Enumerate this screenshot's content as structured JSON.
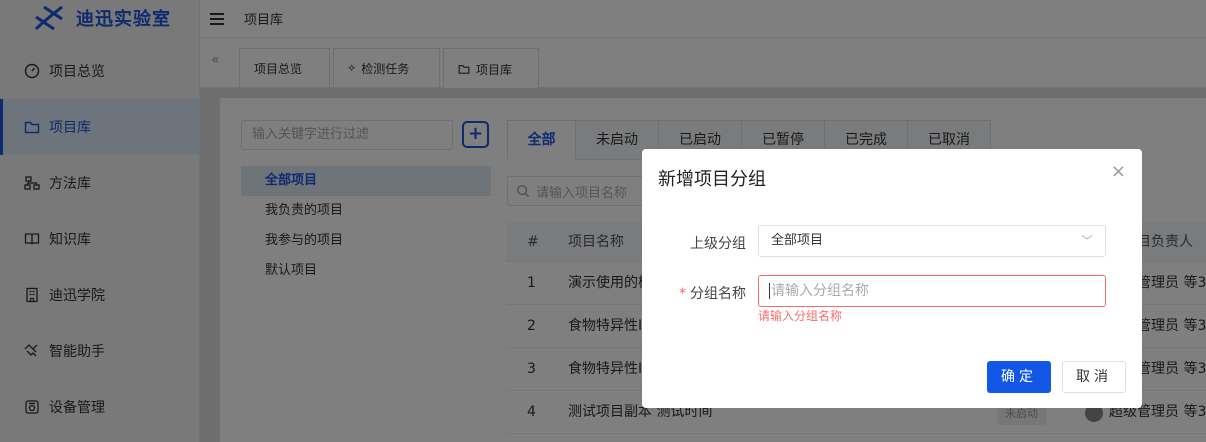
{
  "app": {
    "brand": "迪迅实验室",
    "brand_color": "#1a56db"
  },
  "sidebar": {
    "items": [
      {
        "label": "项目总览",
        "icon": "dashboard-icon"
      },
      {
        "label": "项目库",
        "icon": "folder-icon",
        "active": true
      },
      {
        "label": "方法库",
        "icon": "network-icon"
      },
      {
        "label": "知识库",
        "icon": "book-icon"
      },
      {
        "label": "迪迅学院",
        "icon": "building-icon"
      },
      {
        "label": "智能助手",
        "icon": "handshake-icon"
      },
      {
        "label": "设备管理",
        "icon": "device-icon"
      }
    ]
  },
  "topbar": {
    "breadcrumb": "项目库"
  },
  "page_tabs": [
    {
      "label": "项目总览"
    },
    {
      "label": "检测任务",
      "icon": "task-icon"
    },
    {
      "label": "项目库",
      "icon": "folder-icon",
      "active": true
    }
  ],
  "left_panel": {
    "filter_placeholder": "输入关键字进行过滤",
    "add_label": "+",
    "tree": [
      "全部项目",
      "我负责的项目",
      "我参与的项目",
      "默认项目"
    ]
  },
  "status_tabs": [
    "全部",
    "未启动",
    "已启动",
    "已暂停",
    "已完成",
    "已取消"
  ],
  "search": {
    "placeholder": "请输入项目名称"
  },
  "table": {
    "columns": [
      "#",
      "项目名称",
      "目负责人"
    ],
    "rows": [
      {
        "no": "1",
        "name": "演示使用的检",
        "owner": "管理员 等3"
      },
      {
        "no": "2",
        "name": "食物特异性IgG",
        "owner": "管理员 等3"
      },
      {
        "no": "3",
        "name": "食物特异性IgG",
        "owner": "管理员 等3"
      },
      {
        "no": "4",
        "name": "测试项目副本 测试时间",
        "status": "未启动",
        "owner": "超级管理员 等3"
      }
    ]
  },
  "modal": {
    "title": "新增项目分组",
    "close": "×",
    "parent_label": "上级分组",
    "parent_value": "全部项目",
    "name_required_mark": "*",
    "name_label": "分组名称",
    "name_placeholder": "请输入分组名称",
    "name_error": "请输入分组名称",
    "ok": "确定",
    "cancel": "取消"
  }
}
